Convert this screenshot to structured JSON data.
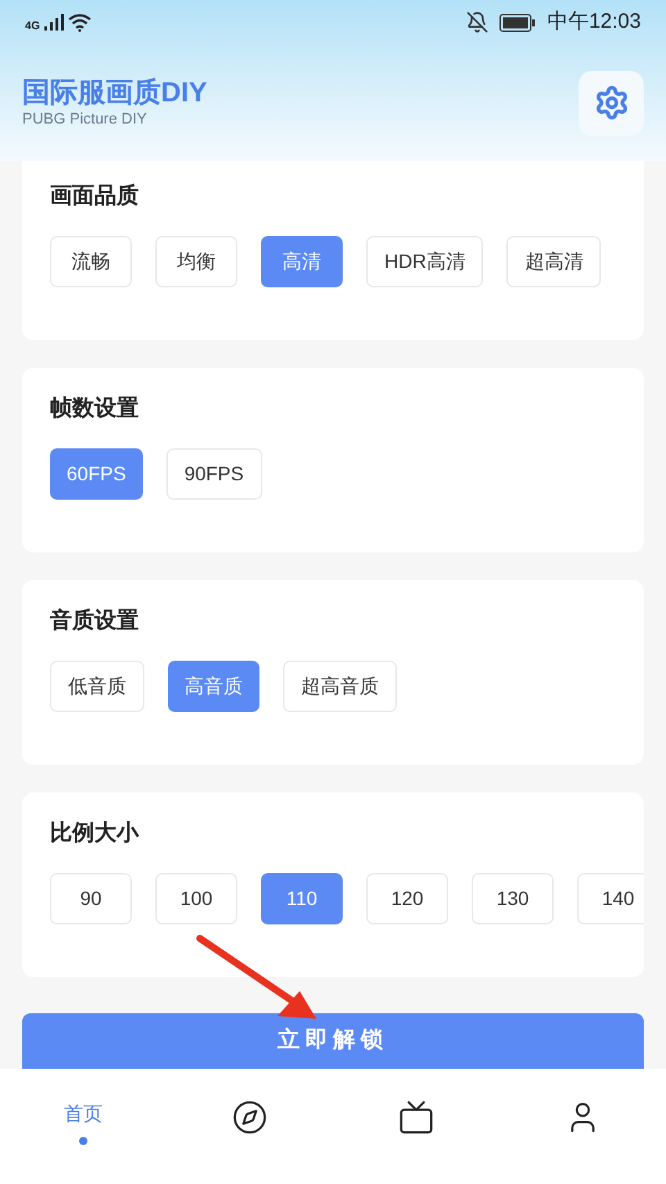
{
  "status_bar": {
    "network": "4G",
    "time": "中午12:03"
  },
  "header": {
    "title": "国际服画质DIY",
    "subtitle": "PUBG Picture DIY"
  },
  "sections": [
    {
      "title": "画面品质",
      "options": [
        {
          "label": "流畅",
          "selected": false
        },
        {
          "label": "均衡",
          "selected": false
        },
        {
          "label": "高清",
          "selected": true
        },
        {
          "label": "HDR高清",
          "selected": false
        },
        {
          "label": "超高清",
          "selected": false
        }
      ]
    },
    {
      "title": "帧数设置",
      "options": [
        {
          "label": "60FPS",
          "selected": true
        },
        {
          "label": "90FPS",
          "selected": false
        }
      ]
    },
    {
      "title": "音质设置",
      "options": [
        {
          "label": "低音质",
          "selected": false
        },
        {
          "label": "高音质",
          "selected": true
        },
        {
          "label": "超高音质",
          "selected": false
        }
      ]
    },
    {
      "title": "比例大小",
      "options": [
        {
          "label": "90",
          "selected": false
        },
        {
          "label": "100",
          "selected": false
        },
        {
          "label": "110",
          "selected": true
        },
        {
          "label": "120",
          "selected": false
        },
        {
          "label": "130",
          "selected": false
        },
        {
          "label": "140",
          "selected": false
        }
      ]
    }
  ],
  "unlock_button": "立即解锁",
  "bottom_nav": [
    {
      "kind": "text",
      "label": "首页",
      "selected": true
    },
    {
      "kind": "compass",
      "selected": false
    },
    {
      "kind": "tv",
      "selected": false
    },
    {
      "kind": "person",
      "selected": false
    }
  ]
}
